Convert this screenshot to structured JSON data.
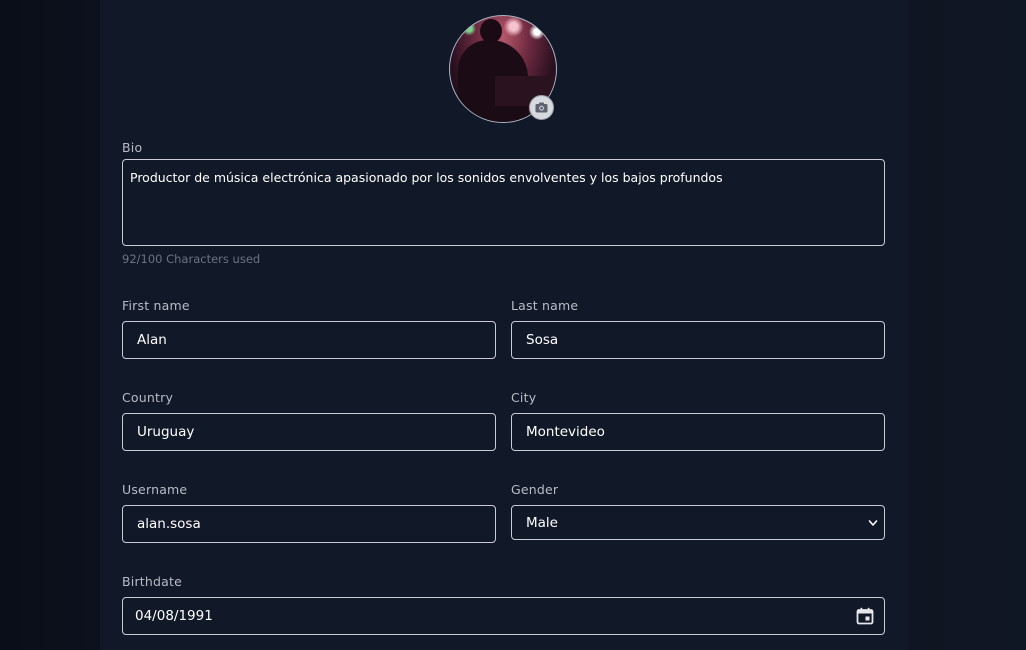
{
  "profile": {
    "avatar_icon": "camera-icon"
  },
  "bio": {
    "label": "Bio",
    "value": "Productor de música electrónica apasionado por los sonidos envolventes y los bajos profundos",
    "counter": "92/100 Characters used"
  },
  "first_name": {
    "label": "First name",
    "value": "Alan"
  },
  "last_name": {
    "label": "Last name",
    "value": "Sosa"
  },
  "country": {
    "label": "Country",
    "value": "Uruguay"
  },
  "city": {
    "label": "City",
    "value": "Montevideo"
  },
  "username": {
    "label": "Username",
    "value": "alan.sosa"
  },
  "gender": {
    "label": "Gender",
    "value": "Male"
  },
  "birthdate": {
    "label": "Birthdate",
    "value": "04/08/1991"
  },
  "colors": {
    "background": "#0b101c",
    "panel": "#111827",
    "border": "#c7ccd4",
    "label": "#b7bcc6",
    "helper": "#6b7383"
  }
}
